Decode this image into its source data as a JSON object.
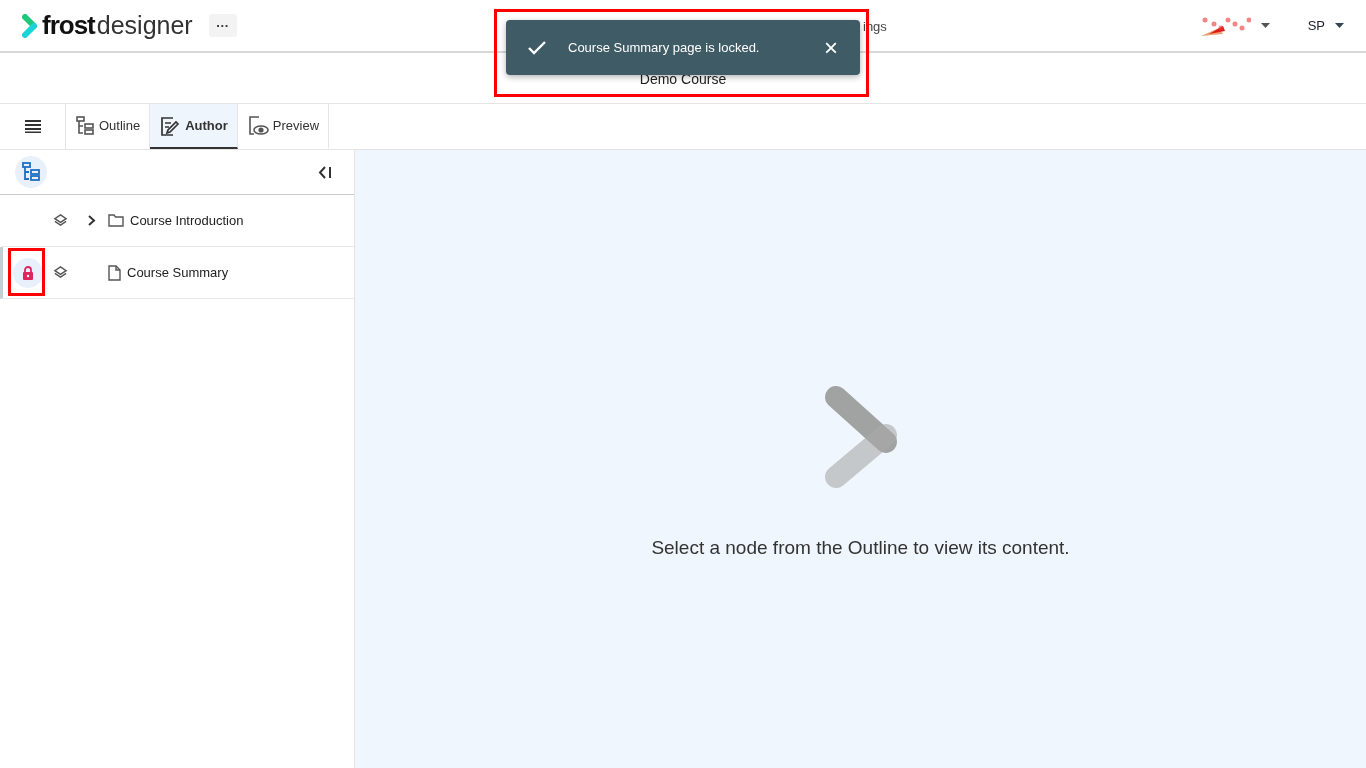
{
  "header": {
    "logo_bold": "frost",
    "logo_light": "designer",
    "more_button": "···",
    "nav_partial": "ings",
    "user": "SP"
  },
  "toast": {
    "message": "Course Summary page is locked.",
    "close": "×"
  },
  "course_title": "Demo Course",
  "tabs": [
    {
      "label": "Outline",
      "selected": false
    },
    {
      "label": "Author",
      "selected": true
    },
    {
      "label": "Preview",
      "selected": false
    }
  ],
  "tree": [
    {
      "label": "Course Introduction",
      "kind": "folder",
      "expanded": false,
      "locked": false,
      "selected": false
    },
    {
      "label": "Course Summary",
      "kind": "page",
      "locked": true,
      "selected": true
    }
  ],
  "empty_state": "Select a node from the Outline to view its content."
}
